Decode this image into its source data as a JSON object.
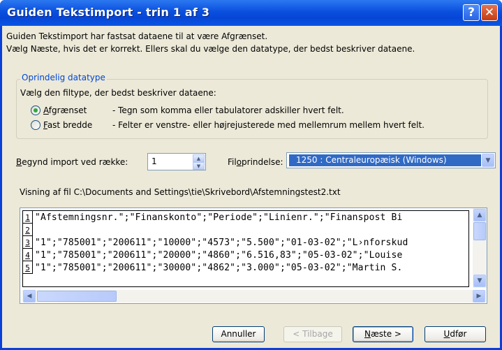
{
  "window": {
    "title": "Guiden Tekstimport - trin 1 af 3",
    "help_glyph": "?",
    "close_glyph": "✕"
  },
  "intro": {
    "line1": "Guiden Tekstimport har fastsat dataene til at være Afgrænset.",
    "line2": "Vælg Næste, hvis det er korrekt. Ellers skal du vælge den datatype, der bedst beskriver dataene."
  },
  "datatype_group": {
    "legend": "Oprindelig datatype",
    "prompt": "Vælg den filtype, der bedst beskriver dataene:",
    "options": [
      {
        "label": "Afgrænset",
        "access_key": "A",
        "rest": "fgrænset",
        "description": "- Tegn som komma eller tabulatorer adskiller hvert felt.",
        "selected": true
      },
      {
        "label": "Fast bredde",
        "access_key": "F",
        "rest": "ast bredde",
        "description": "- Felter er venstre- eller højrejusterede med mellemrum mellem hvert felt.",
        "selected": false
      }
    ]
  },
  "start_row": {
    "label_key": "B",
    "label_rest": "egynd import ved række:",
    "value": "1"
  },
  "origin": {
    "label_pre": "Fil",
    "label_key": "o",
    "label_post": "prindelse:",
    "selected": "1250 : Centraleuropæisk (Windows)"
  },
  "preview": {
    "label": "Visning af fil C:\\Documents and Settings\\tie\\Skrivebord\\Afstemningstest2.txt",
    "rows": [
      {
        "n": "1",
        "text": "\"Afstemningsnr.\";\"Finanskonto\";\"Periode\";\"Linienr.\";\"Finanspost Bi"
      },
      {
        "n": "2",
        "text": ""
      },
      {
        "n": "3",
        "text": "\"1\";\"785001\";\"200611\";\"10000\";\"4573\";\"5.500\";\"01-03-02\";\"L›nforskud"
      },
      {
        "n": "4",
        "text": "\"1\";\"785001\";\"200611\";\"20000\";\"4860\";\"6.516,83\";\"05-03-02\";\"Louise"
      },
      {
        "n": "5",
        "text": "\"1\";\"785001\";\"200611\";\"30000\";\"4862\";\"3.000\";\"05-03-02\";\"Martin S."
      }
    ]
  },
  "buttons": {
    "cancel": "Annuller",
    "back": "< Tilbage",
    "next_key": "N",
    "next_rest": "æste >",
    "finish_key": "U",
    "finish_rest": "dfør"
  },
  "colors": {
    "title_bar": "#0a4fde",
    "dialog_bg": "#ece9d8",
    "selection": "#316ac5",
    "group_legend": "#0046d5"
  },
  "icons": {
    "spin_up": "▲",
    "spin_down": "▼",
    "dropdown": "▼",
    "scroll_up": "▲",
    "scroll_down": "▼",
    "scroll_left": "◀",
    "scroll_right": "▶"
  }
}
